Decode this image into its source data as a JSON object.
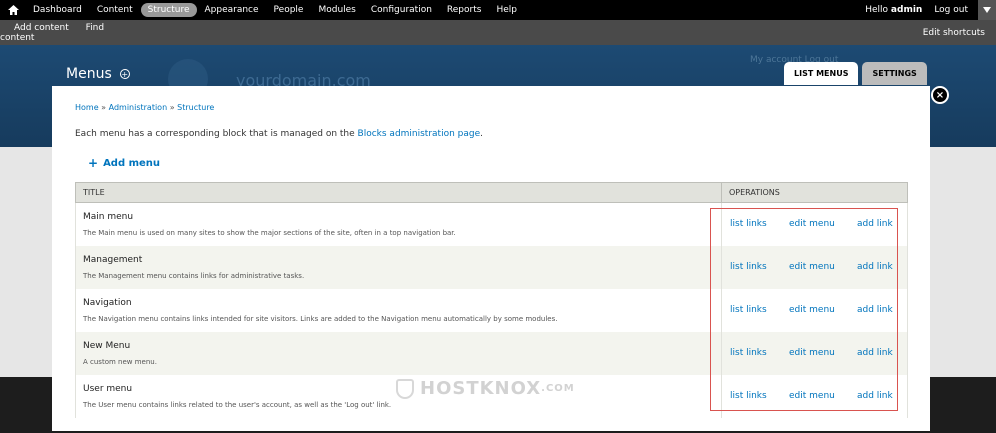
{
  "toolbar": {
    "items": [
      "Dashboard",
      "Content",
      "Structure",
      "Appearance",
      "People",
      "Modules",
      "Configuration",
      "Reports",
      "Help"
    ],
    "active": "Structure",
    "hello": "Hello ",
    "user": "admin",
    "logout": "Log out"
  },
  "shortcuts": {
    "add_content": "Add content",
    "find_content": "Find content",
    "edit_shortcuts": "Edit shortcuts"
  },
  "header": {
    "title": "Menus",
    "site_name": "yourdomain.com",
    "account_links": "My account   Log out",
    "tabs": [
      "LIST MENUS",
      "SETTINGS"
    ]
  },
  "overlay": {
    "close": "×",
    "breadcrumb": [
      "Home",
      "Administration",
      "Structure"
    ],
    "breadcrumb_sep": " » ",
    "description_prefix": "Each menu has a corresponding block that is managed on the ",
    "description_link": "Blocks administration page",
    "description_suffix": ".",
    "add_menu": "Add menu",
    "table": {
      "headers": [
        "TITLE",
        "OPERATIONS"
      ],
      "rows": [
        {
          "name": "Main menu",
          "desc": "The Main menu is used on many sites to show the major sections of the site, often in a top navigation bar."
        },
        {
          "name": "Management",
          "desc": "The Management menu contains links for administrative tasks."
        },
        {
          "name": "Navigation",
          "desc": "The Navigation menu contains links intended for site visitors. Links are added to the Navigation menu automatically by some modules."
        },
        {
          "name": "New Menu",
          "desc": "A custom new menu."
        },
        {
          "name": "User menu",
          "desc": "The User menu contains links related to the user's account, as well as the 'Log out' link."
        }
      ],
      "ops": [
        "list links",
        "edit menu",
        "add link"
      ]
    }
  },
  "watermark": {
    "text": "HOSTKNOX",
    "suffix": ".COM"
  }
}
